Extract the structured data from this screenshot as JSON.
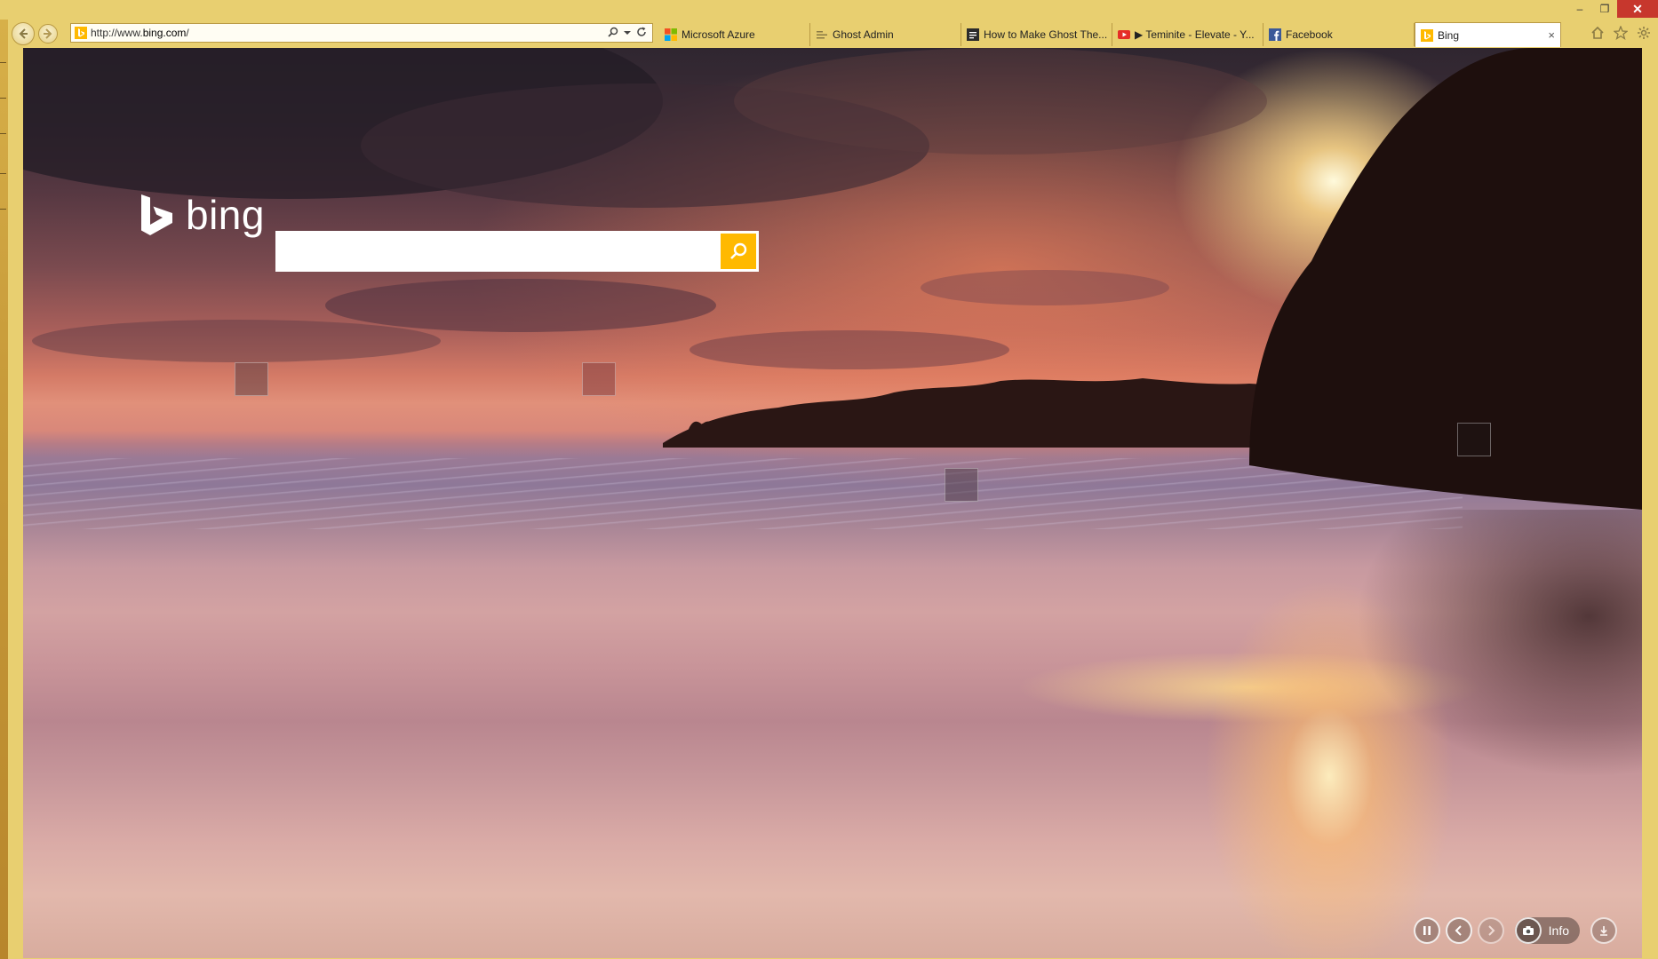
{
  "window": {
    "controls": {
      "minimize": "–",
      "restore": "❐",
      "close": "✕"
    }
  },
  "address_bar": {
    "url_prefix": "http://www.",
    "url_host": "bing.com",
    "url_suffix": "/",
    "icons": [
      "search-icon",
      "dropdown-icon",
      "refresh-icon"
    ]
  },
  "tabs": [
    {
      "label": "Microsoft Azure",
      "icon": "windows-logo-icon",
      "active": false
    },
    {
      "label": "Ghost Admin",
      "icon": "ghost-icon",
      "active": false
    },
    {
      "label": "How to Make Ghost The...",
      "icon": "page-icon",
      "active": false
    },
    {
      "label": "▶ Teminite - Elevate - Y...",
      "icon": "youtube-icon",
      "active": false
    },
    {
      "label": "Facebook",
      "icon": "facebook-icon",
      "active": false
    },
    {
      "label": "Bing",
      "icon": "bing-icon",
      "active": true,
      "close": "×"
    }
  ],
  "toolbar_right": [
    "home-icon",
    "favorites-icon",
    "settings-icon"
  ],
  "bing": {
    "logo_text": "bing",
    "search_placeholder": "",
    "search_value": ""
  },
  "bottom_controls": {
    "info_label": "Info",
    "pause": "⏸",
    "prev": "‹",
    "next": "›"
  },
  "colors": {
    "frame": "#e8cf70",
    "close": "#c7372d",
    "search_accent": "#ffb900"
  }
}
